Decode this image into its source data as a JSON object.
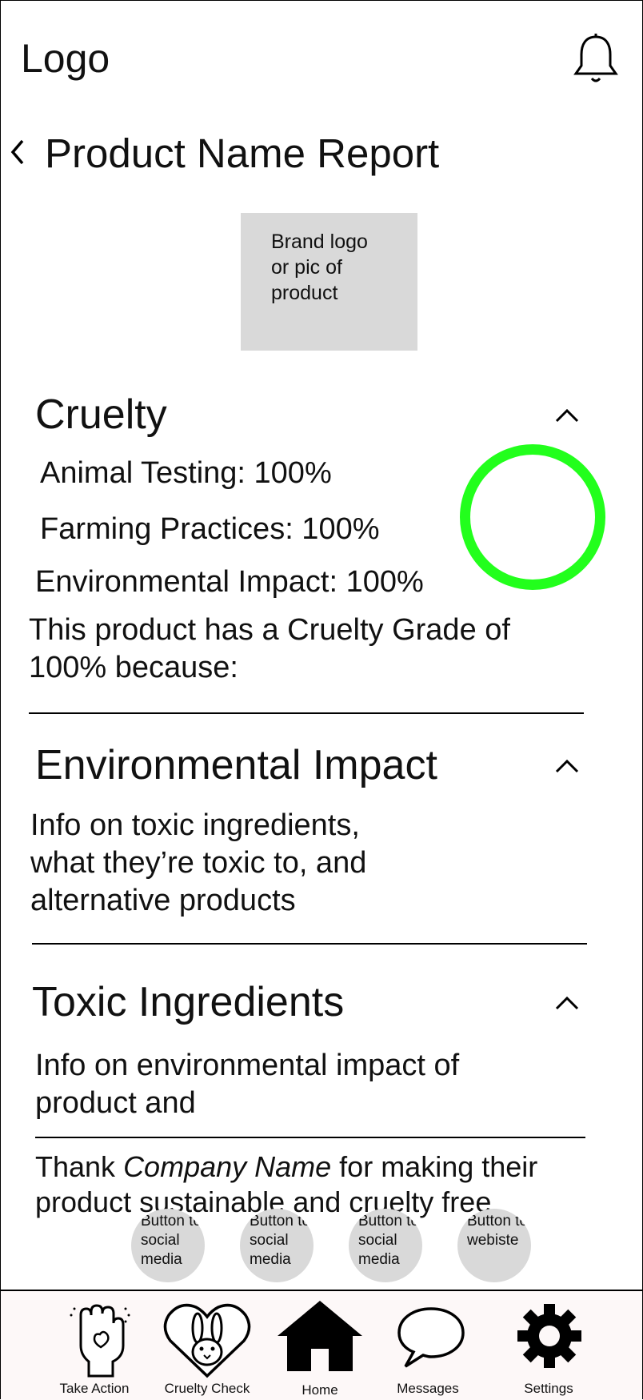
{
  "header": {
    "logo": "Logo",
    "bell_icon": "bell-icon",
    "back_icon": "chevron-left-icon",
    "title": "Product Name Report"
  },
  "brand_placeholder": "Brand logo or pic of product",
  "sections": [
    {
      "heading": "Cruelty",
      "lines": [
        "Animal Testing: 100%",
        "Farming Practices: 100%",
        "Environmental Impact: 100%"
      ],
      "summary": "This product has a Cruelty Grade of 100% because:",
      "grade_ring_color": "#22ff1c",
      "grade_ring_fraction": 1.0
    },
    {
      "heading": "Environmental Impact",
      "body": "Info on toxic ingredients, what they’re toxic to, and alternative products"
    },
    {
      "heading": "Toxic Ingredients",
      "body": "Info on environmental impact of product and"
    }
  ],
  "thanks": {
    "prefix": "Thank ",
    "company": "Company Name",
    "suffix": " for making their product sustainable and cruelty free"
  },
  "social_buttons": [
    {
      "label": "Button to social media"
    },
    {
      "label": "Button to social media"
    },
    {
      "label": "Button to social media"
    },
    {
      "label": "Button to webiste"
    }
  ],
  "nav": [
    {
      "label": "Take Action",
      "icon": "raised-fist-heart-icon"
    },
    {
      "label": "Cruelty Check",
      "icon": "bunny-heart-icon"
    },
    {
      "label": "Home",
      "icon": "home-icon"
    },
    {
      "label": "Messages",
      "icon": "speech-bubble-icon"
    },
    {
      "label": "Settings",
      "icon": "gear-icon"
    }
  ]
}
